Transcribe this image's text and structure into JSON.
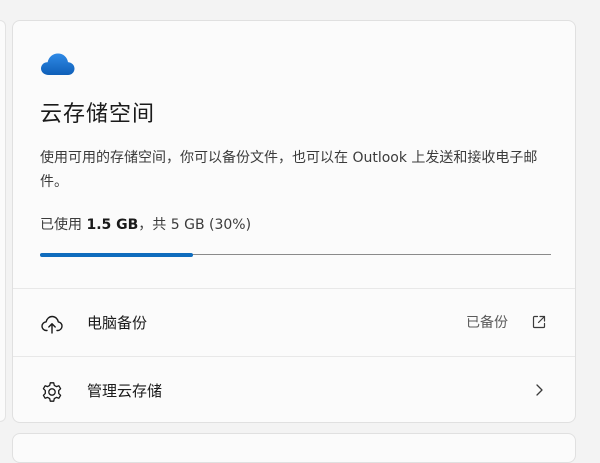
{
  "storage": {
    "title": "云存储空间",
    "description": "使用可用的存储空间，你可以备份文件，也可以在 Outlook 上发送和接收电子邮件。",
    "usage_prefix": "已使用 ",
    "used": "1.5 GB",
    "usage_suffix": "，共 5 GB (30%)",
    "percent_used": 30,
    "accent_color": "#0f6cbd"
  },
  "rows": [
    {
      "label": "电脑备份",
      "status": "已备份",
      "icon": "cloud-upload-icon",
      "trail_icon": "external-link-icon"
    },
    {
      "label": "管理云存储",
      "icon": "gear-icon",
      "trail_icon": "chevron-right-icon"
    }
  ]
}
